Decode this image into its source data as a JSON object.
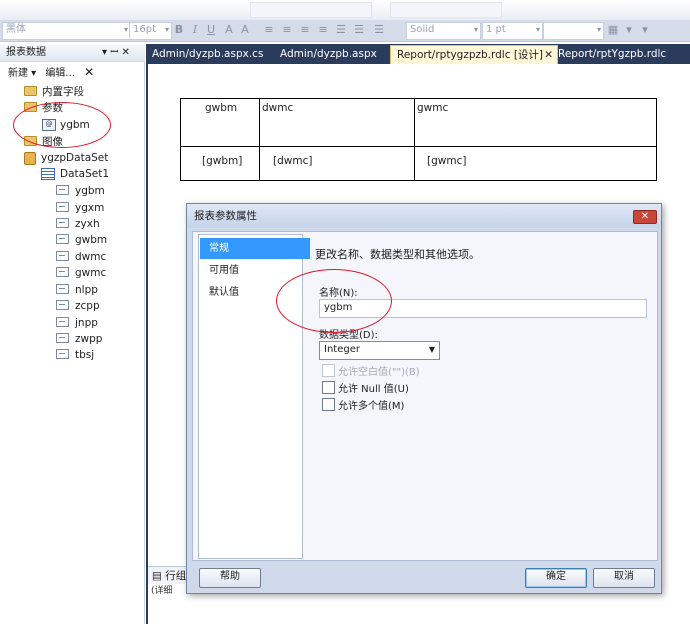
{
  "toolbar": {
    "font_name": "黑体",
    "font_size": "16pt",
    "line_style": "Solid",
    "line_width": "1 pt"
  },
  "left_panel": {
    "title": "报表数据",
    "pin": "▾ ꟷ ✕",
    "new_label": "新建 ▾",
    "edit_label": "编辑...",
    "tree": [
      {
        "label": "内置字段",
        "icon": "folder-icon"
      },
      {
        "label": "参数",
        "icon": "folder-open-icon"
      },
      {
        "label": "ygbm",
        "icon": "parameter-icon"
      },
      {
        "label": "图像",
        "icon": "folder-icon"
      },
      {
        "label": "ygzpDataSet",
        "icon": "database-icon"
      },
      {
        "label": "DataSet1",
        "icon": "table-icon"
      },
      {
        "label": "ygbm",
        "icon": "field-icon"
      },
      {
        "label": "ygxm",
        "icon": "field-icon"
      },
      {
        "label": "zyxh",
        "icon": "field-icon"
      },
      {
        "label": "gwbm",
        "icon": "field-icon"
      },
      {
        "label": "dwmc",
        "icon": "field-icon"
      },
      {
        "label": "gwmc",
        "icon": "field-icon"
      },
      {
        "label": "nlpp",
        "icon": "field-icon"
      },
      {
        "label": "zcpp",
        "icon": "field-icon"
      },
      {
        "label": "jnpp",
        "icon": "field-icon"
      },
      {
        "label": "zwpp",
        "icon": "field-icon"
      },
      {
        "label": "tbsj",
        "icon": "field-icon"
      }
    ]
  },
  "tabs": [
    {
      "label": "Admin/dyzpb.aspx.cs"
    },
    {
      "label": "Admin/dyzpb.aspx"
    },
    {
      "label": "Report/rptygzpzb.rdlc [设计]"
    },
    {
      "label": "Report/rptYgzpb.rdlc"
    }
  ],
  "tab_close": "✕",
  "report_table": {
    "headers": [
      "gwbm",
      "dwmc",
      "gwmc"
    ],
    "values": [
      "[gwbm]",
      "[dwmc]",
      "[gwmc]"
    ]
  },
  "dialog": {
    "title": "报表参数属性",
    "close": "✕",
    "nav": [
      "常规",
      "可用值",
      "默认值"
    ],
    "description": "更改名称、数据类型和其他选项。",
    "name_label": "名称(N):",
    "name_value": "ygbm",
    "type_label": "数据类型(D):",
    "type_value": "Integer",
    "checkboxes": [
      {
        "label": "允许空白值(\"\")(B)",
        "checked": false,
        "disabled": true
      },
      {
        "label": "允许 Null 值(U)",
        "checked": false,
        "disabled": false
      },
      {
        "label": "允许多个值(M)",
        "checked": false,
        "disabled": false
      }
    ],
    "help_button": "帮助",
    "ok_button": "确定",
    "cancel_button": "取消"
  },
  "bottom": {
    "row_groups": "行组",
    "detail": "(详细"
  }
}
